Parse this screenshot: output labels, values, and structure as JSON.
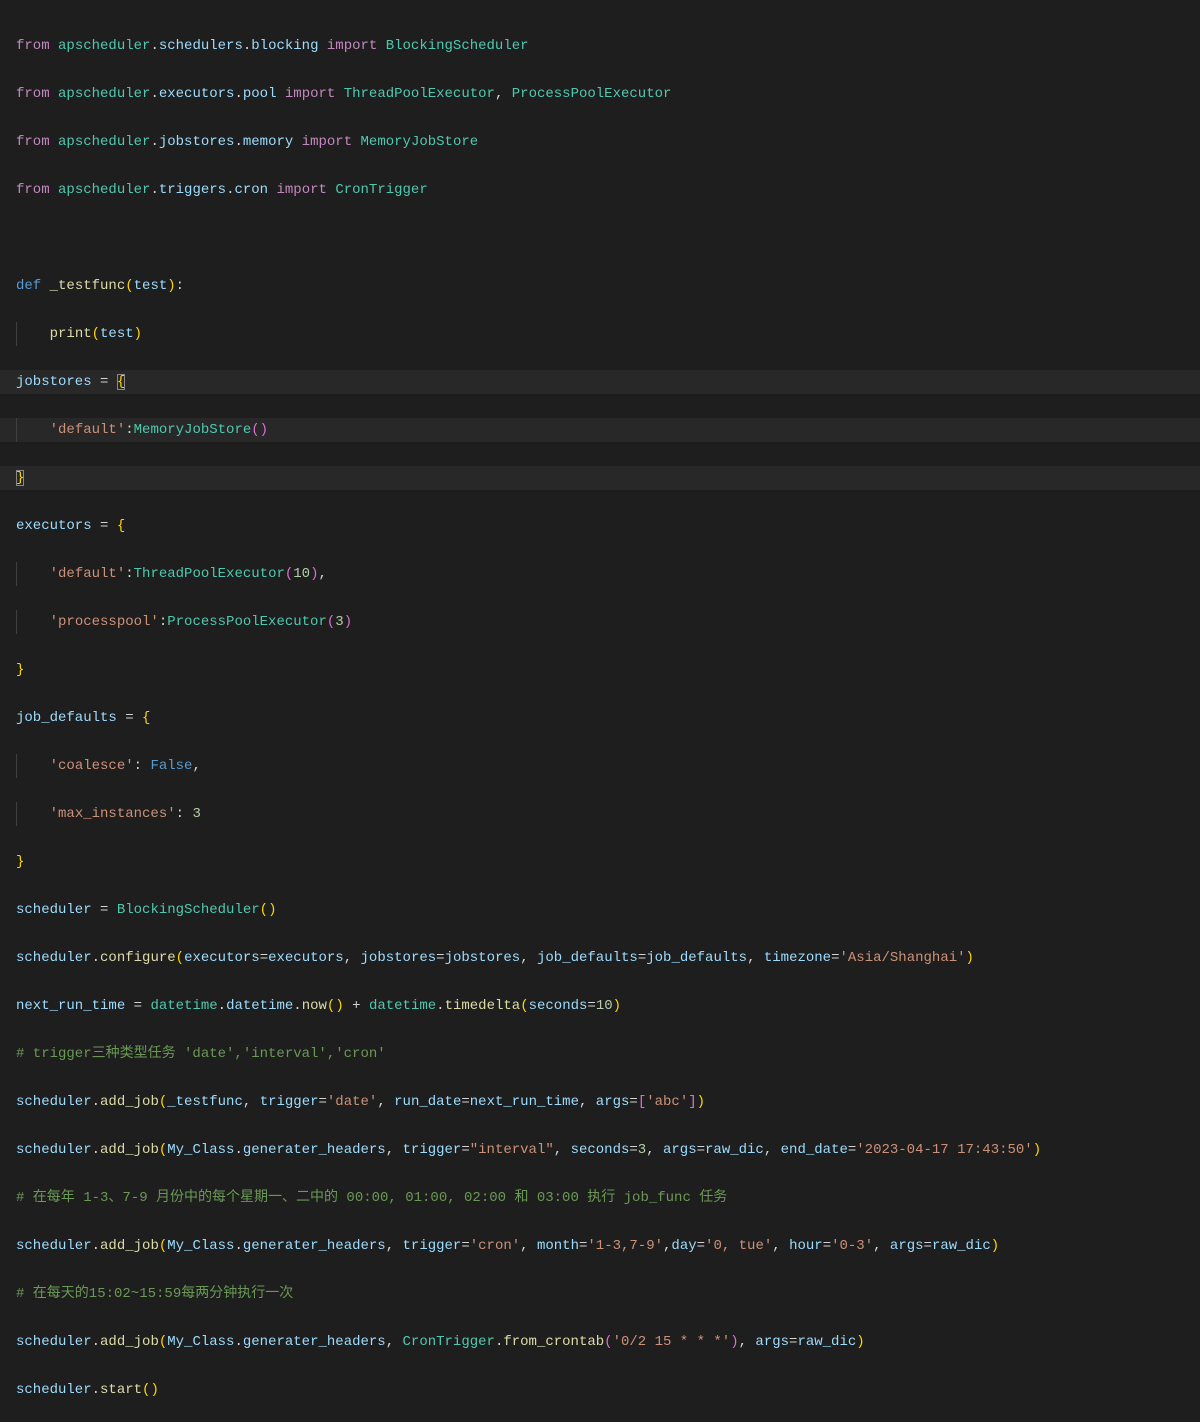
{
  "lines": {
    "l1": {
      "from": "from",
      "mod": "apscheduler",
      "p1": "schedulers",
      "p2": "blocking",
      "imp": "import",
      "cls": "BlockingScheduler"
    },
    "l2": {
      "from": "from",
      "mod": "apscheduler",
      "p1": "executors",
      "p2": "pool",
      "imp": "import",
      "cls1": "ThreadPoolExecutor",
      "cls2": "ProcessPoolExecutor"
    },
    "l3": {
      "from": "from",
      "mod": "apscheduler",
      "p1": "jobstores",
      "p2": "memory",
      "imp": "import",
      "cls": "MemoryJobStore"
    },
    "l4": {
      "from": "from",
      "mod": "apscheduler",
      "p1": "triggers",
      "p2": "cron",
      "imp": "import",
      "cls": "CronTrigger"
    },
    "l6": {
      "def": "def",
      "name": "_testfunc",
      "param": "test"
    },
    "l7": {
      "fn": "print",
      "arg": "test"
    },
    "l8": {
      "var": "jobstores"
    },
    "l9": {
      "key": "'default'",
      "cls": "MemoryJobStore"
    },
    "l11": {
      "var": "executors"
    },
    "l12": {
      "key": "'default'",
      "cls": "ThreadPoolExecutor",
      "n": "10"
    },
    "l13": {
      "key": "'processpool'",
      "cls": "ProcessPoolExecutor",
      "n": "3"
    },
    "l15": {
      "var": "job_defaults"
    },
    "l16": {
      "key": "'coalesce'",
      "val": "False"
    },
    "l17": {
      "key": "'max_instances'",
      "val": "3"
    },
    "l19": {
      "var": "scheduler",
      "cls": "BlockingScheduler"
    },
    "l20": {
      "obj": "scheduler",
      "fn": "configure",
      "p1": "executors",
      "v1": "executors",
      "p2": "jobstores",
      "v2": "jobstores",
      "p3": "job_defaults",
      "v3": "job_defaults",
      "p4": "timezone",
      "v4": "'Asia/Shanghai'"
    },
    "l21": {
      "var": "next_run_time",
      "m1": "datetime",
      "m2": "datetime",
      "fn1": "now",
      "m3": "datetime",
      "fn2": "timedelta",
      "p": "seconds",
      "n": "10"
    },
    "l22": {
      "c": "# trigger三种类型任务 'date','interval','cron'"
    },
    "l23": {
      "obj": "scheduler",
      "fn": "add_job",
      "a1": "_testfunc",
      "p1": "trigger",
      "v1": "'date'",
      "p2": "run_date",
      "v2": "next_run_time",
      "p3": "args",
      "v3": "'abc'"
    },
    "l24": {
      "obj": "scheduler",
      "fn": "add_job",
      "a1": "My_Class",
      "a2": "generater_headers",
      "p1": "trigger",
      "v1": "\"interval\"",
      "p2": "seconds",
      "v2": "3",
      "p3": "args",
      "v3": "raw_dic",
      "p4": "end_date",
      "v4": "'2023-04-17 17:43:50'"
    },
    "l25": {
      "c": "# 在每年 1-3、7-9 月份中的每个星期一、二中的 00:00, 01:00, 02:00 和 03:00 执行 job_func 任务"
    },
    "l26": {
      "obj": "scheduler",
      "fn": "add_job",
      "a1": "My_Class",
      "a2": "generater_headers",
      "p1": "trigger",
      "v1": "'cron'",
      "p2": "month",
      "v2": "'1-3,7-9'",
      "p3": "day",
      "v3": "'0, tue'",
      "p4": "hour",
      "v4": "'0-3'",
      "p5": "args",
      "v5": "raw_dic"
    },
    "l27": {
      "c": "# 在每天的15:02~15:59每两分钟执行一次"
    },
    "l28": {
      "obj": "scheduler",
      "fn": "add_job",
      "a1": "My_Class",
      "a2": "generater_headers",
      "cls": "CronTrigger",
      "fn2": "from_crontab",
      "arg": "'0/2 15 * * *'",
      "p1": "args",
      "v1": "raw_dic"
    },
    "l29": {
      "obj": "scheduler",
      "fn": "start"
    }
  }
}
